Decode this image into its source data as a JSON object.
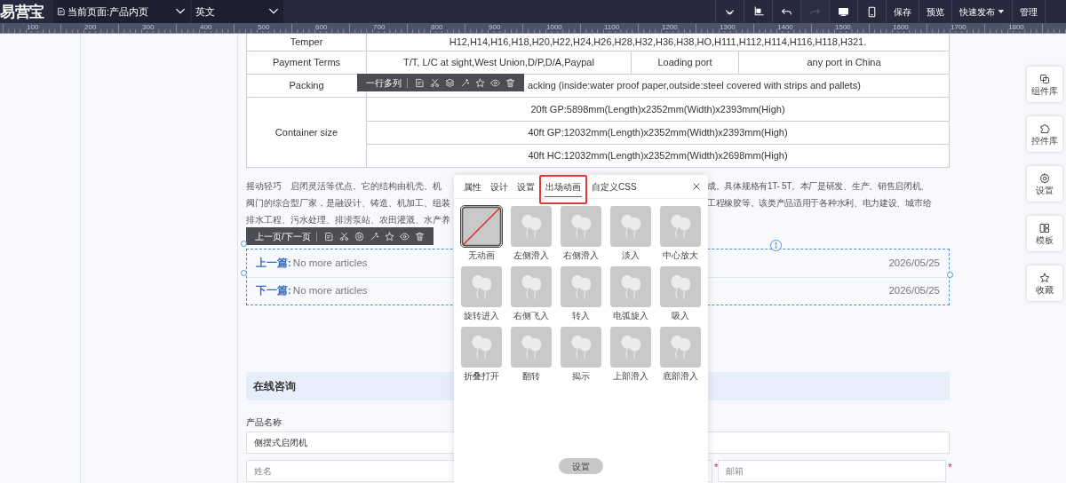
{
  "top_bar": {
    "logo": "易营宝",
    "page_select": "当前页面:产品内页",
    "language_select": "英文",
    "tools": [
      {
        "kind": "collapse",
        "disabled": false
      },
      {
        "kind": "crop",
        "disabled": false
      },
      {
        "kind": "undo",
        "disabled": false
      },
      {
        "kind": "redo",
        "disabled": true
      },
      {
        "kind": "desktop",
        "disabled": false
      },
      {
        "kind": "mobile",
        "disabled": false
      }
    ],
    "actions": [
      {
        "label": "保存",
        "dropdown": false
      },
      {
        "label": "预览",
        "dropdown": false
      },
      {
        "label": "快速发布",
        "dropdown": true
      },
      {
        "label": "管理",
        "dropdown": false
      }
    ]
  },
  "ruler_labels": [
    "100",
    "200",
    "300",
    "400",
    "500",
    "600",
    "700",
    "800",
    "900",
    "1000",
    "1100",
    "1200",
    "1300",
    "1400",
    "1500",
    "1600",
    "1700",
    "1800"
  ],
  "spec_table": [
    {
      "kind": "single",
      "label": "Temper",
      "cells": [
        "H12,H14,H16,H18,H20,H22,H24,H26,H28,H32,H36,H38,HO,H111,H112,H114,H116,H118,H321."
      ]
    },
    {
      "kind": "split",
      "label": "Payment Terms",
      "cells": [
        "T/T, L/C at sight,West Union,D/P,D/A,Paypal",
        "Loading port",
        "any port in China"
      ]
    },
    {
      "kind": "single",
      "label": "Packing",
      "cells": [
        "acking (inside:water proof paper,outside:steel covered with strips and pallets)"
      ]
    },
    {
      "kind": "stacked",
      "label": "Container size",
      "cells": [
        "20ft GP:5898mm(Length)x2352mm(Width)x2393mm(High)",
        "40ft GP:12032mm(Length)x2352mm(Width)x2393mm(High)",
        "40ft HC:12032mm(Length)x2352mm(Width)x2698mm(High)"
      ]
    }
  ],
  "element_toolbars": [
    {
      "label": "一行多列"
    },
    {
      "label": "上一页/下一页"
    }
  ],
  "paragraph": {
    "left_lines": [
      "摇动轻巧　启闭灵活等优点。它的结构由机壳、机",
      "阀门的综合型厂家，是融设计、铸造、机加工、组装",
      "排水工程、污水处理、排涝泵站、农田灌溉、水产养"
    ],
    "right_lines": [
      "成。具体规格有1T- 5T。本厂是研发、生产、销售启闭机、",
      "工程橡胶等。该类产品适用于各种水利、电力建设、城市给"
    ]
  },
  "article_nav": [
    {
      "label": "上一篇:",
      "text": "No more articles",
      "date": "2026/05/25"
    },
    {
      "label": "下一篇:",
      "text": "No more articles",
      "date": "2026/05/25"
    }
  ],
  "form": {
    "title": "在线咨询",
    "product_label": "产品名称",
    "product_value": "侧摆式启闭机",
    "fields": [
      {
        "placeholder": "姓名",
        "required_mark": "*"
      },
      {
        "placeholder": "邮箱",
        "required_mark": "*"
      }
    ]
  },
  "popup": {
    "tabs": [
      {
        "label": "属性",
        "selected": false
      },
      {
        "label": "设计",
        "selected": false
      },
      {
        "label": "设置",
        "selected": false
      },
      {
        "label": "出场动画",
        "selected": true
      },
      {
        "label": "自定义CSS",
        "selected": false
      }
    ],
    "animations": [
      {
        "label": "无动画",
        "kind": "none",
        "selected": true
      },
      {
        "label": "左侧滑入",
        "kind": "balloon",
        "selected": false
      },
      {
        "label": "右侧滑入",
        "kind": "balloon",
        "selected": false
      },
      {
        "label": "淡入",
        "kind": "balloon",
        "selected": false
      },
      {
        "label": "中心放大",
        "kind": "balloon",
        "selected": false
      },
      {
        "label": "旋转进入",
        "kind": "balloon",
        "selected": false
      },
      {
        "label": "右侧飞入",
        "kind": "balloon",
        "selected": false
      },
      {
        "label": "转入",
        "kind": "balloon",
        "selected": false
      },
      {
        "label": "电弧旋入",
        "kind": "balloon",
        "selected": false
      },
      {
        "label": "吸入",
        "kind": "balloon",
        "selected": false
      },
      {
        "label": "折叠打开",
        "kind": "balloon",
        "selected": false
      },
      {
        "label": "翻转",
        "kind": "balloon",
        "selected": false
      },
      {
        "label": "揭示",
        "kind": "balloon",
        "selected": false
      },
      {
        "label": "上部滑入",
        "kind": "balloon",
        "selected": false
      },
      {
        "label": "底部滑入",
        "kind": "balloon",
        "selected": false
      }
    ],
    "button": "设置"
  },
  "side_dock": [
    {
      "label": "组件库"
    },
    {
      "label": "控件库"
    },
    {
      "label": "设置"
    },
    {
      "label": "模板"
    },
    {
      "label": "收藏"
    }
  ]
}
